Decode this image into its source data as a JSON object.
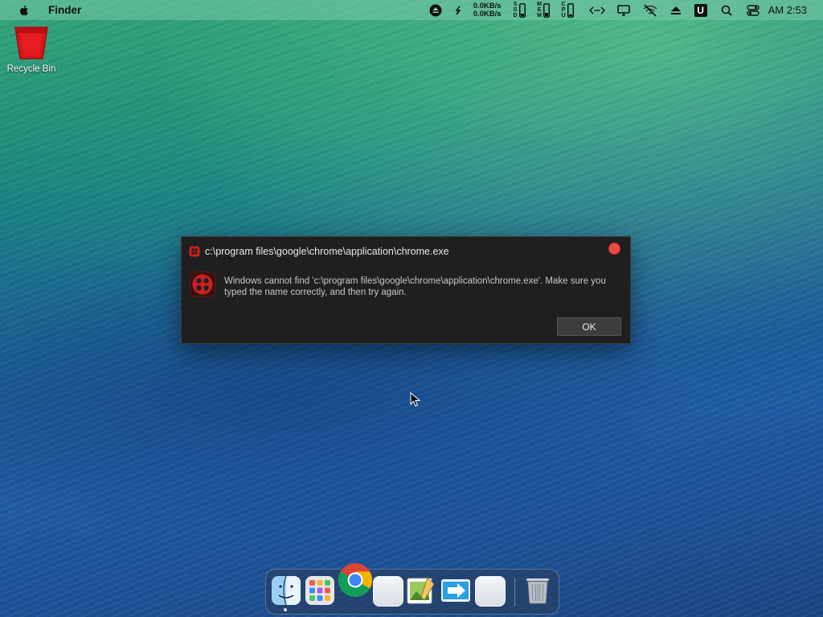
{
  "menubar": {
    "app_name": "Finder",
    "net_up": "0.0KB/s",
    "net_down": "0.0KB/s",
    "battery_labels": [
      "SSD",
      "MEM",
      "CPU"
    ],
    "user_badge": "U",
    "clock": "AM 2:53"
  },
  "desktop": {
    "icons": [
      {
        "label": "Recycle Bin",
        "icon": "recycle-bin-icon"
      }
    ]
  },
  "dialog": {
    "title": "c:\\program files\\google\\chrome\\application\\chrome.exe",
    "message": "Windows cannot find 'c:\\program files\\google\\chrome\\application\\chrome.exe'. Make sure you typed the name correctly, and then try again.",
    "ok_label": "OK"
  },
  "dock": {
    "items": [
      "finder-icon",
      "launchpad-icon",
      "chrome-icon",
      "blank-app-icon",
      "image-editor-icon",
      "migration-icon",
      "blank-app-icon",
      "trash-icon"
    ]
  },
  "colors": {
    "close_button": "#ec4b44",
    "dialog_bg": "#1f1f1f",
    "error_icon": "#cc1f1f"
  }
}
